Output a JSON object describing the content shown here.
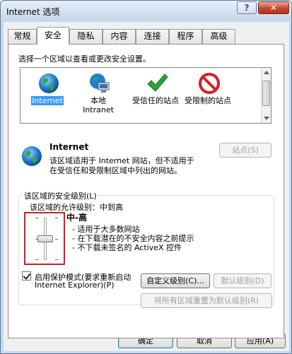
{
  "window": {
    "title": "Internet 选项",
    "help_glyph": "?",
    "close_glyph": "✕"
  },
  "tabs": [
    "常规",
    "安全",
    "隐私",
    "内容",
    "连接",
    "程序",
    "高级"
  ],
  "active_tab": "安全",
  "zones_prompt": "选择一个区域以查看或更改安全设置。",
  "zones": [
    {
      "label": "Internet",
      "icon": "globe-icon",
      "selected": true
    },
    {
      "label_line1": "本地",
      "label_line2": "Intranet",
      "icon": "intranet-icon"
    },
    {
      "label": "受信任的站点",
      "icon": "checkmark-icon"
    },
    {
      "label": "受限制的站点",
      "icon": "restricted-icon"
    }
  ],
  "zone_detail": {
    "name": "Internet",
    "description_line1": "该区域适用于 Internet 网站，但不适用于",
    "description_line2": "在受信任和受限制区域中列出的网站。",
    "sites_button": "站点(S)"
  },
  "security_level": {
    "group_label": "该区域的安全级别(L)",
    "allowed_levels": "该区域的允许级别：中到高",
    "level_name": "中-高",
    "bullets": [
      "- 适用于大多数网站",
      "- 在下载潜在的不安全内容之前提示",
      "- 不下载未签名的 ActiveX 控件"
    ],
    "slider_position": "中-高"
  },
  "protected_mode": {
    "checked": true,
    "label_line1": "启用保护模式(要求重新启动",
    "label_line2": "Internet Explorer)(P)"
  },
  "buttons": {
    "custom_level": "自定义级别(C)...",
    "default_level": "默认级别(D)",
    "reset_all": "将所有区域重置为默认级别(R)",
    "ok": "确定",
    "cancel": "取消",
    "apply": "应用(A)"
  },
  "colors": {
    "highlight": "#3399ff",
    "slider_outline": "#d32020",
    "restricted": "#d52020",
    "trusted": "#2fa336"
  }
}
